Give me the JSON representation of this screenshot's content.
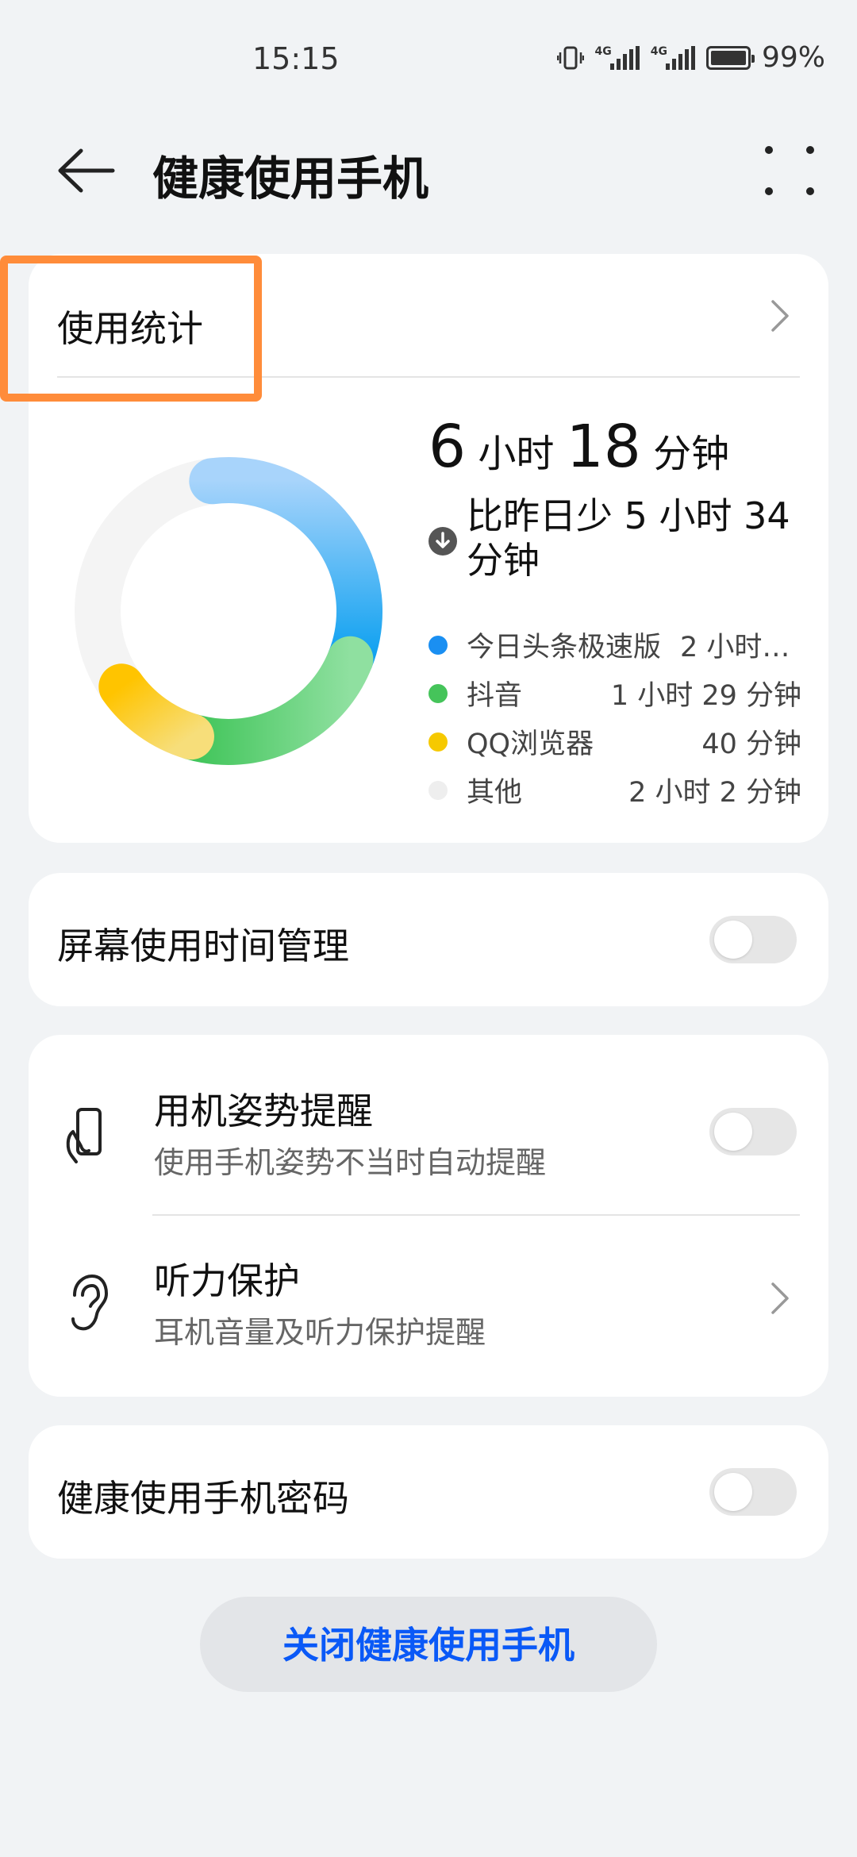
{
  "status_bar": {
    "time": "15:15",
    "battery": "99%",
    "network_1": "4G",
    "network_2": "4G"
  },
  "header": {
    "title": "健康使用手机",
    "back_icon": "arrow-left-icon",
    "more_icon": "more-dots-icon"
  },
  "stats": {
    "title": "使用统计",
    "total_hours": "6",
    "hours_unit": "小时",
    "total_minutes": "18",
    "minutes_unit": "分钟",
    "compare_text": "比昨日少 5 小时 34 分钟",
    "apps": [
      {
        "name": "今日头条极速版",
        "time": "2 小时…",
        "color": "#1a8ff2",
        "fraction": 0.33
      },
      {
        "name": "抖音",
        "time": "1 小时 29 分钟",
        "color": "#45c45a",
        "fraction": 0.236
      },
      {
        "name": "QQ浏览器",
        "time": "40 分钟",
        "color": "#f6c900",
        "fraction": 0.106
      },
      {
        "name": "其他",
        "time": "2 小时 2 分钟",
        "color": "#eeeeee",
        "fraction": 0.323
      }
    ]
  },
  "screen_time": {
    "label": "屏幕使用时间管理",
    "enabled": false
  },
  "posture": {
    "title": "用机姿势提醒",
    "subtitle": "使用手机姿势不当时自动提醒",
    "enabled": false,
    "icon": "phone-hand-icon"
  },
  "hearing": {
    "title": "听力保护",
    "subtitle": "耳机音量及听力保护提醒",
    "icon": "ear-icon"
  },
  "password": {
    "label": "健康使用手机密码",
    "enabled": false
  },
  "close_button": "关闭健康使用手机",
  "accent_color": "#0a59f7",
  "highlight_color": "#ff8c3a"
}
